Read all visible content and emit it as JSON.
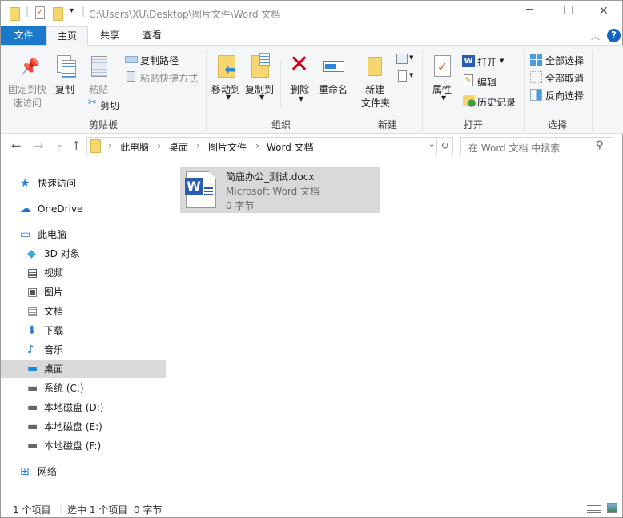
{
  "title_bar": {
    "path": "C:\\Users\\XU\\Desktop\\图片文件\\Word 文档",
    "minimize": "─",
    "maximize": "☐",
    "close": "✕"
  },
  "tabs": [
    {
      "label": "文件"
    },
    {
      "label": "主页"
    },
    {
      "label": "共享"
    },
    {
      "label": "查看"
    }
  ],
  "ribbon": {
    "clipboard": {
      "pin": "固定到快",
      "pin2": "速访问",
      "copy": "复制",
      "paste": "粘贴",
      "copy_path": "复制路径",
      "paste_shortcut": "粘贴快捷方式",
      "cut": "剪切",
      "group": "剪贴板"
    },
    "organize": {
      "move_to": "移动到",
      "copy_to": "复制到",
      "delete": "删除",
      "rename": "重命名",
      "group": "组织"
    },
    "new": {
      "new_folder": "新建",
      "new_folder2": "文件夹",
      "group": "新建"
    },
    "open": {
      "properties": "属性",
      "open": "打开",
      "edit": "编辑",
      "history": "历史记录",
      "group": "打开"
    },
    "select": {
      "select_all": "全部选择",
      "select_none": "全部取消",
      "invert": "反向选择",
      "group": "选择"
    },
    "help": "?"
  },
  "address": {
    "crumbs": [
      "此电脑",
      "桌面",
      "图片文件",
      "Word 文档"
    ],
    "search_placeholder": "在 Word 文档 中搜索"
  },
  "nav": [
    {
      "label": "快速访问",
      "icon": "star-icon"
    },
    {
      "label": "OneDrive",
      "icon": "cloud-icon"
    },
    {
      "label": "此电脑",
      "icon": "computer-icon"
    },
    {
      "label": "3D 对象",
      "icon": "cube-icon"
    },
    {
      "label": "视频",
      "icon": "video-icon"
    },
    {
      "label": "图片",
      "icon": "picture-icon"
    },
    {
      "label": "文档",
      "icon": "document-icon"
    },
    {
      "label": "下载",
      "icon": "download-icon"
    },
    {
      "label": "音乐",
      "icon": "music-icon"
    },
    {
      "label": "桌面",
      "icon": "desktop-icon",
      "selected": true
    },
    {
      "label": "系统 (C:)",
      "icon": "drive-icon"
    },
    {
      "label": "本地磁盘 (D:)",
      "icon": "drive-icon"
    },
    {
      "label": "本地磁盘 (E:)",
      "icon": "drive-icon"
    },
    {
      "label": "本地磁盘 (F:)",
      "icon": "drive-icon"
    },
    {
      "label": "网络",
      "icon": "network-icon"
    }
  ],
  "file": {
    "name": "简鹿办公_测试.docx",
    "type": "Microsoft Word 文档",
    "size": "0 字节",
    "icon_letter": "W"
  },
  "status": {
    "count": "1 个项目",
    "selected": "选中 1 个项目",
    "size": "0 字节"
  },
  "colors": {
    "accent": "#1979ca",
    "selected": "#d9d9d9",
    "word": "#2b5cb4"
  }
}
